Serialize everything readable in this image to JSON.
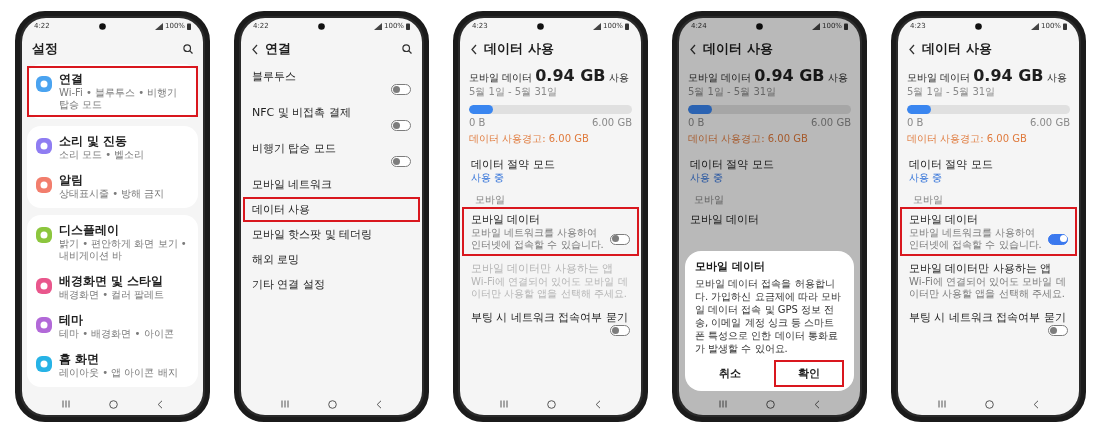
{
  "phones": [
    {
      "time": "4:22",
      "battery": "100%",
      "header": {
        "title": "설정",
        "back": false,
        "search": true
      },
      "dimmed": false,
      "content": [
        {
          "kind": "group",
          "items": [
            {
              "title": "연결",
              "subtitle": "Wi-Fi • 블루투스 • 비행기 탑승 모드",
              "color": "#4aa3f0",
              "highlighted": true
            }
          ]
        },
        {
          "kind": "group",
          "items": [
            {
              "title": "소리 및 진동",
              "subtitle": "소리 모드 • 벨소리",
              "color": "#8f7df2",
              "highlighted": false
            },
            {
              "title": "알림",
              "subtitle": "상태표시줄 • 방해 금지",
              "color": "#f27e6d",
              "highlighted": false
            }
          ]
        },
        {
          "kind": "group",
          "items": [
            {
              "title": "디스플레이",
              "subtitle": "밝기 • 편안하게 화면 보기 • 내비게이션 바",
              "color": "#8cc63e",
              "highlighted": false
            },
            {
              "title": "배경화면 및 스타일",
              "subtitle": "배경화면 • 컬러 팔레트",
              "color": "#e9578c",
              "highlighted": false
            },
            {
              "title": "테마",
              "subtitle": "테마 • 배경화면 • 아이콘",
              "color": "#b269d8",
              "highlighted": false
            },
            {
              "title": "홈 화면",
              "subtitle": "레이아웃 • 앱 아이콘 배지",
              "color": "#27b3e6",
              "highlighted": false
            }
          ]
        }
      ]
    },
    {
      "time": "4:22",
      "battery": "100%",
      "header": {
        "title": "연결",
        "back": true,
        "search": true
      },
      "dimmed": false,
      "content": [
        {
          "kind": "row",
          "title": "블루투스",
          "switch_on": false,
          "highlighted": false,
          "disabled": false
        },
        {
          "kind": "row",
          "title": "NFC 및 비접촉 결제",
          "switch_on": false,
          "highlighted": false,
          "disabled": false
        },
        {
          "kind": "row",
          "title": "비행기 탑승 모드",
          "switch_on": false,
          "highlighted": false,
          "disabled": false
        },
        {
          "kind": "row",
          "title": "모바일 네트워크",
          "highlighted": false,
          "disabled": false
        },
        {
          "kind": "row",
          "title": "데이터 사용",
          "highlighted": true,
          "disabled": false
        },
        {
          "kind": "row",
          "title": "모바일 핫스팟 및 테더링",
          "highlighted": false,
          "disabled": false
        },
        {
          "kind": "row",
          "title": "해외 로밍",
          "highlighted": false,
          "disabled": false
        },
        {
          "kind": "row",
          "title": "기타 연결 설정",
          "highlighted": false,
          "disabled": false
        }
      ]
    },
    {
      "time": "4:23",
      "battery": "100%",
      "header": {
        "title": "데이터 사용",
        "back": true,
        "search": false
      },
      "dimmed": false,
      "content": [
        {
          "kind": "usage",
          "label": "모바일 데이터",
          "amount": "0.94 GB",
          "suffix": "사용",
          "period": "5월 1일 - 5월 31일",
          "level": 0.15,
          "min": "0 B",
          "max": "6.00 GB",
          "warning": "데이터 사용경고: 6.00 GB"
        },
        {
          "kind": "row",
          "title": "데이터 절약 모드",
          "subtitle": "사용 중",
          "accent": true,
          "highlighted": false,
          "disabled": false
        },
        {
          "kind": "section",
          "title": "모바일"
        },
        {
          "kind": "row",
          "title": "모바일 데이터",
          "subtitle": "모바일 네트워크를 사용하여 인터넷에 접속할 수 있습니다.",
          "switch_on": false,
          "highlighted": true,
          "disabled": false
        },
        {
          "kind": "row",
          "title": "모바일 데이터만 사용하는 앱",
          "subtitle": "Wi-Fi에 연결되어 있어도 모바일 데이터만 사용할 앱을 선택해 주세요.",
          "highlighted": false,
          "disabled": true
        },
        {
          "kind": "row",
          "title": "부팅 시 네트워크 접속여부 묻기",
          "switch_on": false,
          "highlighted": false,
          "disabled": false
        }
      ]
    },
    {
      "time": "4:24",
      "battery": "100%",
      "header": {
        "title": "데이터 사용",
        "back": true,
        "search": false
      },
      "dimmed": true,
      "content": [
        {
          "kind": "usage",
          "label": "모바일 데이터",
          "amount": "0.94 GB",
          "suffix": "사용",
          "period": "5월 1일 - 5월 31일",
          "level": 0.15,
          "min": "0 B",
          "max": "6.00 GB",
          "warning": "데이터 사용경고: 6.00 GB"
        },
        {
          "kind": "row",
          "title": "데이터 절약 모드",
          "subtitle": "사용 중",
          "accent": true,
          "highlighted": false,
          "disabled": false
        },
        {
          "kind": "section",
          "title": "모바일"
        },
        {
          "kind": "row",
          "title": "모바일 데이터",
          "highlighted": false,
          "disabled": false
        }
      ],
      "dialog": {
        "title": "모바일 데이터",
        "text": "모바일 데이터 접속을 허용합니다. 가입하신 요금제에 따라 모바일 데이터 접속 및 GPS 정보 전송, 이메일 계정 싱크 등 스마트폰 특성으로 인한 데이터 통화료가 발생할 수 있어요.",
        "buttons": [
          {
            "label": "취소",
            "highlighted": false
          },
          {
            "label": "확인",
            "highlighted": true
          }
        ]
      }
    },
    {
      "time": "4:23",
      "battery": "100%",
      "header": {
        "title": "데이터 사용",
        "back": true,
        "search": false
      },
      "dimmed": false,
      "content": [
        {
          "kind": "usage",
          "label": "모바일 데이터",
          "amount": "0.94 GB",
          "suffix": "사용",
          "period": "5월 1일 - 5월 31일",
          "level": 0.15,
          "min": "0 B",
          "max": "6.00 GB",
          "warning": "데이터 사용경고: 6.00 GB"
        },
        {
          "kind": "row",
          "title": "데이터 절약 모드",
          "subtitle": "사용 중",
          "accent": true,
          "highlighted": false,
          "disabled": false
        },
        {
          "kind": "section",
          "title": "모바일"
        },
        {
          "kind": "row",
          "title": "모바일 데이터",
          "subtitle": "모바일 네트워크를 사용하여 인터넷에 접속할 수 있습니다.",
          "switch_on": true,
          "highlighted": true,
          "disabled": false
        },
        {
          "kind": "row",
          "title": "모바일 데이터만 사용하는 앱",
          "subtitle": "Wi-Fi에 연결되어 있어도 모바일 데이터만 사용할 앱을 선택해 주세요.",
          "highlighted": false,
          "disabled": false
        },
        {
          "kind": "row",
          "title": "부팅 시 네트워크 접속여부 묻기",
          "switch_on": false,
          "highlighted": false,
          "disabled": false
        }
      ]
    }
  ]
}
